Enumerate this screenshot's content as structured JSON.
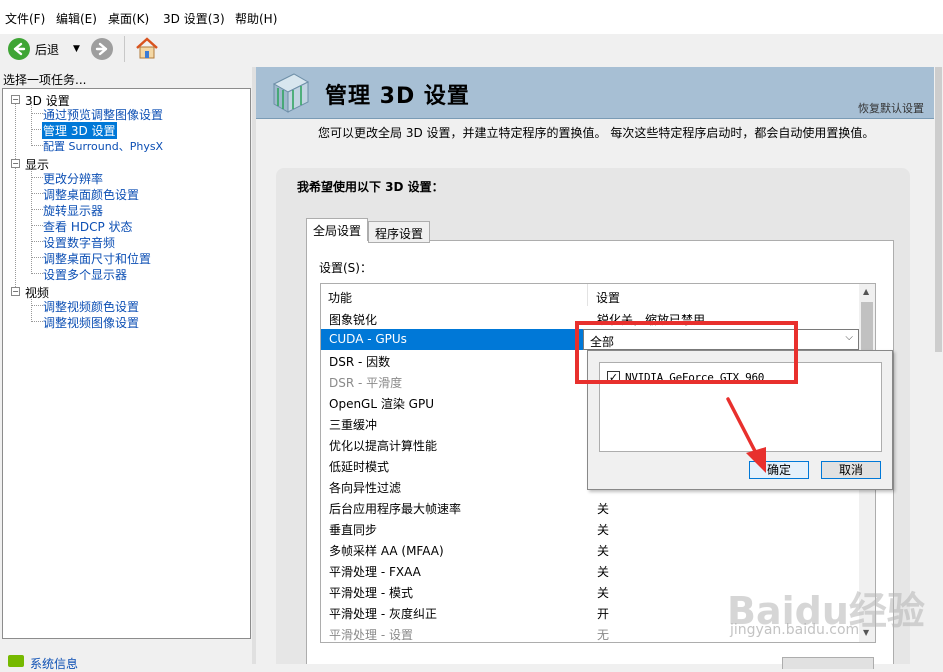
{
  "menubar": {
    "items": [
      "文件(F)",
      "编辑(E)",
      "桌面(K)",
      "3D 设置(3)",
      "帮助(H)"
    ]
  },
  "toolbar": {
    "back_label": "后退"
  },
  "left_panel": {
    "title": "选择一项任务...",
    "tree": [
      {
        "label": "3D 设置",
        "children": [
          "通过预览调整图像设置",
          "管理 3D 设置",
          "配置 Surround、PhysX"
        ]
      },
      {
        "label": "显示",
        "children": [
          "更改分辨率",
          "调整桌面颜色设置",
          "旋转显示器",
          "查看 HDCP 状态",
          "设置数字音频",
          "调整桌面尺寸和位置",
          "设置多个显示器"
        ]
      },
      {
        "label": "视频",
        "children": [
          "调整视频颜色设置",
          "调整视频图像设置"
        ]
      }
    ],
    "selected": "管理 3D 设置",
    "system_info": "系统信息"
  },
  "main": {
    "title": "管理 3D 设置",
    "restore_defaults": "恢复默认设置",
    "description": "您可以更改全局 3D 设置，并建立特定程序的置换值。 每次这些特定程序启动时，都会自动使用置换值。",
    "group_title": "我希望使用以下 3D 设置：",
    "tabs": [
      "全局设置",
      "程序设置"
    ],
    "settings_label": "设置(S)：",
    "columns": [
      "功能",
      "设置"
    ],
    "rows": [
      {
        "feature": "图象锐化",
        "value": "锐化关，缩放已禁用"
      },
      {
        "feature": "CUDA - GPUs",
        "value": "全部"
      },
      {
        "feature": "DSR - 因数",
        "value": ""
      },
      {
        "feature": "DSR - 平滑度",
        "value": ""
      },
      {
        "feature": "OpenGL 渲染 GPU",
        "value": ""
      },
      {
        "feature": "三重缓冲",
        "value": ""
      },
      {
        "feature": "优化以提高计算性能",
        "value": ""
      },
      {
        "feature": "低延时模式",
        "value": ""
      },
      {
        "feature": "各向异性过滤",
        "value": ""
      },
      {
        "feature": "后台应用程序最大帧速率",
        "value": "关"
      },
      {
        "feature": "垂直同步",
        "value": "关"
      },
      {
        "feature": "多帧采样 AA (MFAA)",
        "value": "关"
      },
      {
        "feature": "平滑处理 - FXAA",
        "value": "关"
      },
      {
        "feature": "平滑处理 - 模式",
        "value": "关"
      },
      {
        "feature": "平滑处理 - 灰度纠正",
        "value": "开"
      },
      {
        "feature": "平滑处理 - 设置",
        "value": "无"
      }
    ],
    "combo_value": "全部",
    "popup": {
      "item": "NVIDIA GeForce GTX 960",
      "checked": true,
      "ok": "确定",
      "cancel": "取消"
    }
  },
  "watermark": {
    "text": "Baidu经验",
    "sub": "jingyan.baidu.com"
  },
  "colors": {
    "selection": "#0078d7",
    "header_bg": "#a7bfd4",
    "annotation_red": "#e8302d",
    "link": "#0c4fb4"
  }
}
